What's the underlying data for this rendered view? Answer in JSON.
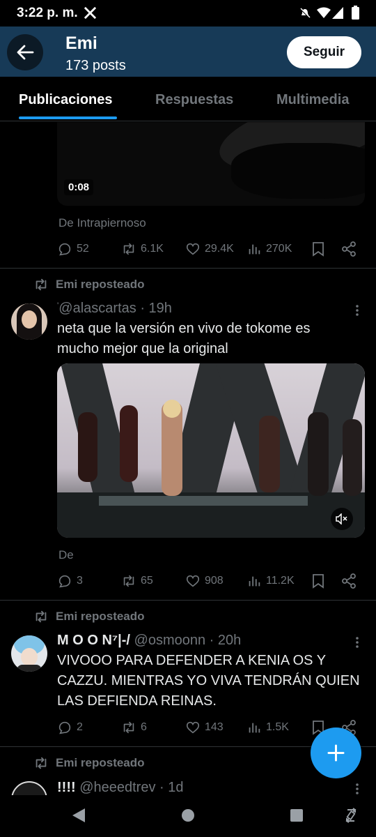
{
  "status_bar": {
    "time": "3:22 p. m.",
    "app_icon": "x-logo-icon",
    "icons": [
      "mute-icon",
      "wifi-icon",
      "signal-icon",
      "battery-icon"
    ]
  },
  "header": {
    "name": "Emi",
    "posts": "173 posts",
    "follow_label": "Seguir",
    "back_icon": "arrow-left-icon"
  },
  "tabs": [
    {
      "label": "Publicaciones",
      "active": true
    },
    {
      "label": "Respuestas",
      "active": false
    },
    {
      "label": "Multimedia",
      "active": false
    }
  ],
  "post1": {
    "video_time": "0:08",
    "source": "De Intrapiernoso",
    "replies": "52",
    "reposts": "6.1K",
    "likes": "29.4K",
    "views": "270K"
  },
  "post2": {
    "repost_label": "Emi reposteado",
    "handle": "@alascartas",
    "time": "· 19h",
    "text": "neta que la versión en vivo de tokome es mucho mejor que la original",
    "source": "De",
    "replies": "3",
    "reposts": "65",
    "likes": "908",
    "views": "11.2K"
  },
  "post3": {
    "repost_label": "Emi reposteado",
    "name": "M O O N⁷|-/",
    "handle": "@osmoonn",
    "time": "· 20h",
    "text": "VIVOOO PARA DEFENDER A KENIA OS Y CAZZU. MIENTRAS YO VIVA TENDRÁN QUIEN LAS DEFIENDA REINAS.",
    "replies": "2",
    "reposts": "6",
    "likes": "143",
    "views": "1.5K"
  },
  "post4": {
    "repost_label": "Emi reposteado",
    "name": "!!!!",
    "handle": "@heeedtrev",
    "time": "· 1d"
  },
  "colors": {
    "accent": "#1d9bf0",
    "header_bg": "#173a57",
    "text": "#e7e9ea",
    "muted": "#71767b"
  }
}
